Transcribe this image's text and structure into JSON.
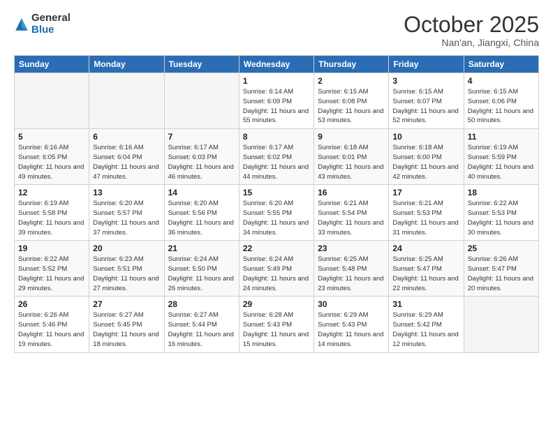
{
  "logo": {
    "general": "General",
    "blue": "Blue"
  },
  "title": "October 2025",
  "location": "Nan'an, Jiangxi, China",
  "weekdays": [
    "Sunday",
    "Monday",
    "Tuesday",
    "Wednesday",
    "Thursday",
    "Friday",
    "Saturday"
  ],
  "weeks": [
    [
      {
        "day": "",
        "info": ""
      },
      {
        "day": "",
        "info": ""
      },
      {
        "day": "",
        "info": ""
      },
      {
        "day": "1",
        "info": "Sunrise: 6:14 AM\nSunset: 6:09 PM\nDaylight: 11 hours\nand 55 minutes."
      },
      {
        "day": "2",
        "info": "Sunrise: 6:15 AM\nSunset: 6:08 PM\nDaylight: 11 hours\nand 53 minutes."
      },
      {
        "day": "3",
        "info": "Sunrise: 6:15 AM\nSunset: 6:07 PM\nDaylight: 11 hours\nand 52 minutes."
      },
      {
        "day": "4",
        "info": "Sunrise: 6:15 AM\nSunset: 6:06 PM\nDaylight: 11 hours\nand 50 minutes."
      }
    ],
    [
      {
        "day": "5",
        "info": "Sunrise: 6:16 AM\nSunset: 6:05 PM\nDaylight: 11 hours\nand 49 minutes."
      },
      {
        "day": "6",
        "info": "Sunrise: 6:16 AM\nSunset: 6:04 PM\nDaylight: 11 hours\nand 47 minutes."
      },
      {
        "day": "7",
        "info": "Sunrise: 6:17 AM\nSunset: 6:03 PM\nDaylight: 11 hours\nand 46 minutes."
      },
      {
        "day": "8",
        "info": "Sunrise: 6:17 AM\nSunset: 6:02 PM\nDaylight: 11 hours\nand 44 minutes."
      },
      {
        "day": "9",
        "info": "Sunrise: 6:18 AM\nSunset: 6:01 PM\nDaylight: 11 hours\nand 43 minutes."
      },
      {
        "day": "10",
        "info": "Sunrise: 6:18 AM\nSunset: 6:00 PM\nDaylight: 11 hours\nand 42 minutes."
      },
      {
        "day": "11",
        "info": "Sunrise: 6:19 AM\nSunset: 5:59 PM\nDaylight: 11 hours\nand 40 minutes."
      }
    ],
    [
      {
        "day": "12",
        "info": "Sunrise: 6:19 AM\nSunset: 5:58 PM\nDaylight: 11 hours\nand 39 minutes."
      },
      {
        "day": "13",
        "info": "Sunrise: 6:20 AM\nSunset: 5:57 PM\nDaylight: 11 hours\nand 37 minutes."
      },
      {
        "day": "14",
        "info": "Sunrise: 6:20 AM\nSunset: 5:56 PM\nDaylight: 11 hours\nand 36 minutes."
      },
      {
        "day": "15",
        "info": "Sunrise: 6:20 AM\nSunset: 5:55 PM\nDaylight: 11 hours\nand 34 minutes."
      },
      {
        "day": "16",
        "info": "Sunrise: 6:21 AM\nSunset: 5:54 PM\nDaylight: 11 hours\nand 33 minutes."
      },
      {
        "day": "17",
        "info": "Sunrise: 6:21 AM\nSunset: 5:53 PM\nDaylight: 11 hours\nand 31 minutes."
      },
      {
        "day": "18",
        "info": "Sunrise: 6:22 AM\nSunset: 5:53 PM\nDaylight: 11 hours\nand 30 minutes."
      }
    ],
    [
      {
        "day": "19",
        "info": "Sunrise: 6:22 AM\nSunset: 5:52 PM\nDaylight: 11 hours\nand 29 minutes."
      },
      {
        "day": "20",
        "info": "Sunrise: 6:23 AM\nSunset: 5:51 PM\nDaylight: 11 hours\nand 27 minutes."
      },
      {
        "day": "21",
        "info": "Sunrise: 6:24 AM\nSunset: 5:50 PM\nDaylight: 11 hours\nand 26 minutes."
      },
      {
        "day": "22",
        "info": "Sunrise: 6:24 AM\nSunset: 5:49 PM\nDaylight: 11 hours\nand 24 minutes."
      },
      {
        "day": "23",
        "info": "Sunrise: 6:25 AM\nSunset: 5:48 PM\nDaylight: 11 hours\nand 23 minutes."
      },
      {
        "day": "24",
        "info": "Sunrise: 6:25 AM\nSunset: 5:47 PM\nDaylight: 11 hours\nand 22 minutes."
      },
      {
        "day": "25",
        "info": "Sunrise: 6:26 AM\nSunset: 5:47 PM\nDaylight: 11 hours\nand 20 minutes."
      }
    ],
    [
      {
        "day": "26",
        "info": "Sunrise: 6:26 AM\nSunset: 5:46 PM\nDaylight: 11 hours\nand 19 minutes."
      },
      {
        "day": "27",
        "info": "Sunrise: 6:27 AM\nSunset: 5:45 PM\nDaylight: 11 hours\nand 18 minutes."
      },
      {
        "day": "28",
        "info": "Sunrise: 6:27 AM\nSunset: 5:44 PM\nDaylight: 11 hours\nand 16 minutes."
      },
      {
        "day": "29",
        "info": "Sunrise: 6:28 AM\nSunset: 5:43 PM\nDaylight: 11 hours\nand 15 minutes."
      },
      {
        "day": "30",
        "info": "Sunrise: 6:29 AM\nSunset: 5:43 PM\nDaylight: 11 hours\nand 14 minutes."
      },
      {
        "day": "31",
        "info": "Sunrise: 6:29 AM\nSunset: 5:42 PM\nDaylight: 11 hours\nand 12 minutes."
      },
      {
        "day": "",
        "info": ""
      }
    ]
  ]
}
